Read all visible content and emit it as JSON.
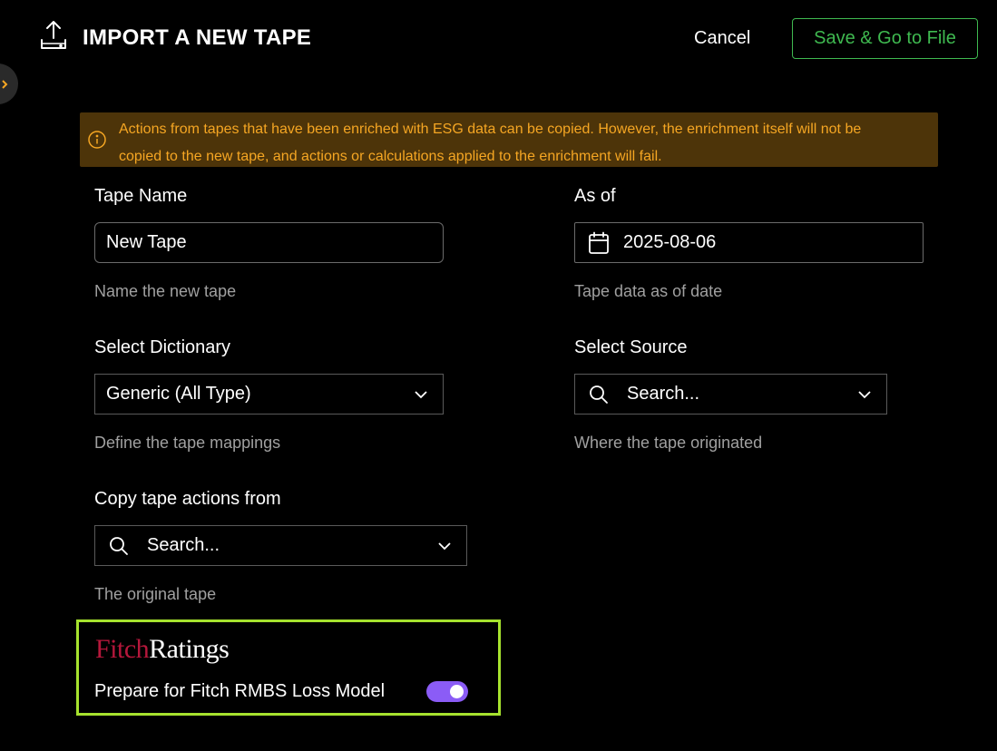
{
  "header": {
    "title": "IMPORT A NEW TAPE",
    "cancel_label": "Cancel",
    "save_label": "Save & Go to File"
  },
  "banner": {
    "text": "Actions from tapes that have been enriched with ESG data can be copied. However, the enrichment itself will not be copied to the new tape, and actions or calculations applied to the enrichment will fail."
  },
  "form": {
    "tape_name": {
      "label": "Tape Name",
      "value": "New Tape",
      "hint": "Name the new tape"
    },
    "as_of": {
      "label": "As of",
      "value": "2025-08-06",
      "hint": "Tape data as of date"
    },
    "dictionary": {
      "label": "Select Dictionary",
      "value": "Generic (All Type)",
      "hint": "Define the tape mappings"
    },
    "source": {
      "label": "Select Source",
      "placeholder": "Search...",
      "hint": "Where the tape originated"
    },
    "copy_actions": {
      "label": "Copy tape actions from",
      "placeholder": "Search...",
      "hint": "The original tape"
    }
  },
  "fitch": {
    "logo_fitch": "Fitch",
    "logo_ratings": "Ratings",
    "toggle_label": "Prepare for Fitch RMBS Loss Model",
    "toggle_on": true
  },
  "colors": {
    "accent_green": "#3fb950",
    "warning_bg": "#4d3409",
    "warning_text": "#f5a623",
    "toggle_purple": "#8b5cf6",
    "highlight_border": "#a6e22e",
    "fitch_red": "#b5173b"
  }
}
